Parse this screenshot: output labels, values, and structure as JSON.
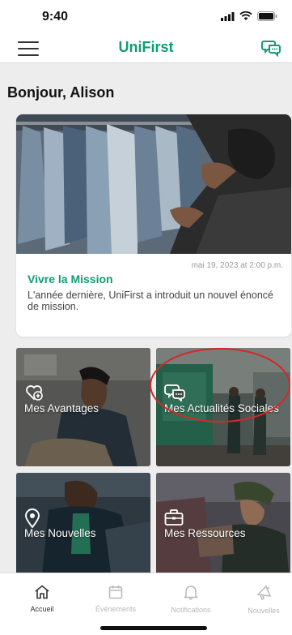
{
  "status_bar": {
    "time": "9:40"
  },
  "header": {
    "title": "UniFirst"
  },
  "greeting": "Bonjour, Alison",
  "featured": {
    "date": "mai 19, 2023 at 2:00 p.m.",
    "title": "Vivre la Mission",
    "description": "L'année dernière, UniFirst a introduit un nouvel énoncé de mission."
  },
  "tiles": [
    {
      "label": "Mes Avantages",
      "icon": "heart-plus-icon"
    },
    {
      "label": "Mes Actualités Sociales",
      "icon": "chat-bubbles-icon"
    },
    {
      "label": "Mes Nouvelles",
      "icon": "location-pin-icon"
    },
    {
      "label": "Mes Ressources",
      "icon": "briefcase-icon"
    }
  ],
  "tab_bar": [
    {
      "label": "Accueil",
      "icon": "home-icon",
      "active": true
    },
    {
      "label": "Événements",
      "icon": "calendar-icon",
      "active": false
    },
    {
      "label": "Notifications",
      "icon": "bell-icon",
      "active": false
    },
    {
      "label": "Nouvelles",
      "icon": "megaphone-icon",
      "active": false
    }
  ],
  "colors": {
    "brand_green": "#0f9d77",
    "annotation_red": "#d62828",
    "background": "#ededed"
  }
}
